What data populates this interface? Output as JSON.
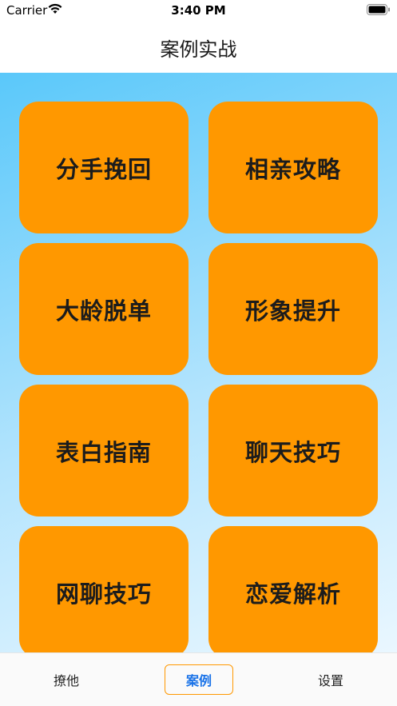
{
  "status_bar": {
    "carrier": "Carrier",
    "time": "3:40 PM"
  },
  "nav": {
    "title": "案例实战"
  },
  "tiles": [
    {
      "label": "分手挽回"
    },
    {
      "label": "相亲攻略"
    },
    {
      "label": "大龄脱单"
    },
    {
      "label": "形象提升"
    },
    {
      "label": "表白指南"
    },
    {
      "label": "聊天技巧"
    },
    {
      "label": "网聊技巧"
    },
    {
      "label": "恋爱解析"
    }
  ],
  "tab_bar": {
    "tabs": [
      {
        "label": "撩他"
      },
      {
        "label": "案例"
      },
      {
        "label": "设置"
      }
    ],
    "active": "案例"
  },
  "colors": {
    "tile": "#ff9800",
    "gradient_top": "#5ac8fa",
    "gradient_bottom": "#eaf7ff",
    "active_tab_text": "#1a73e8",
    "active_tab_border": "#ff9800"
  }
}
